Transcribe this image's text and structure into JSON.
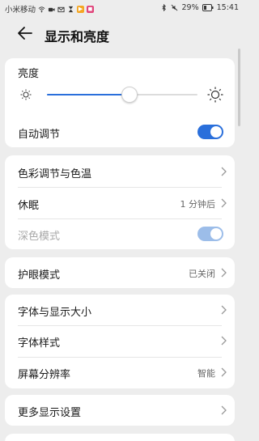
{
  "status_bar": {
    "carrier": "小米移动",
    "battery": "29%",
    "time": "15:41"
  },
  "header": {
    "title": "显示和亮度"
  },
  "brightness": {
    "label": "亮度",
    "level": 0.55
  },
  "auto_adjust": {
    "label": "自动调节",
    "on": true
  },
  "group1": {
    "color_temp": {
      "label": "色彩调节与色温"
    },
    "sleep": {
      "label": "休眠",
      "value": "1 分钟后"
    },
    "dark_mode": {
      "label": "深色模式"
    }
  },
  "group2": {
    "eye_comfort": {
      "label": "护眼模式",
      "value": "已关闭"
    }
  },
  "group3": {
    "font_size": {
      "label": "字体与显示大小"
    },
    "font_style": {
      "label": "字体样式"
    },
    "resolution": {
      "label": "屏幕分辨率",
      "value": "智能"
    }
  },
  "group4": {
    "more": {
      "label": "更多显示设置"
    }
  },
  "colors": {
    "accent": "#2a6fdb",
    "background": "#ededed",
    "card": "#ffffff"
  }
}
